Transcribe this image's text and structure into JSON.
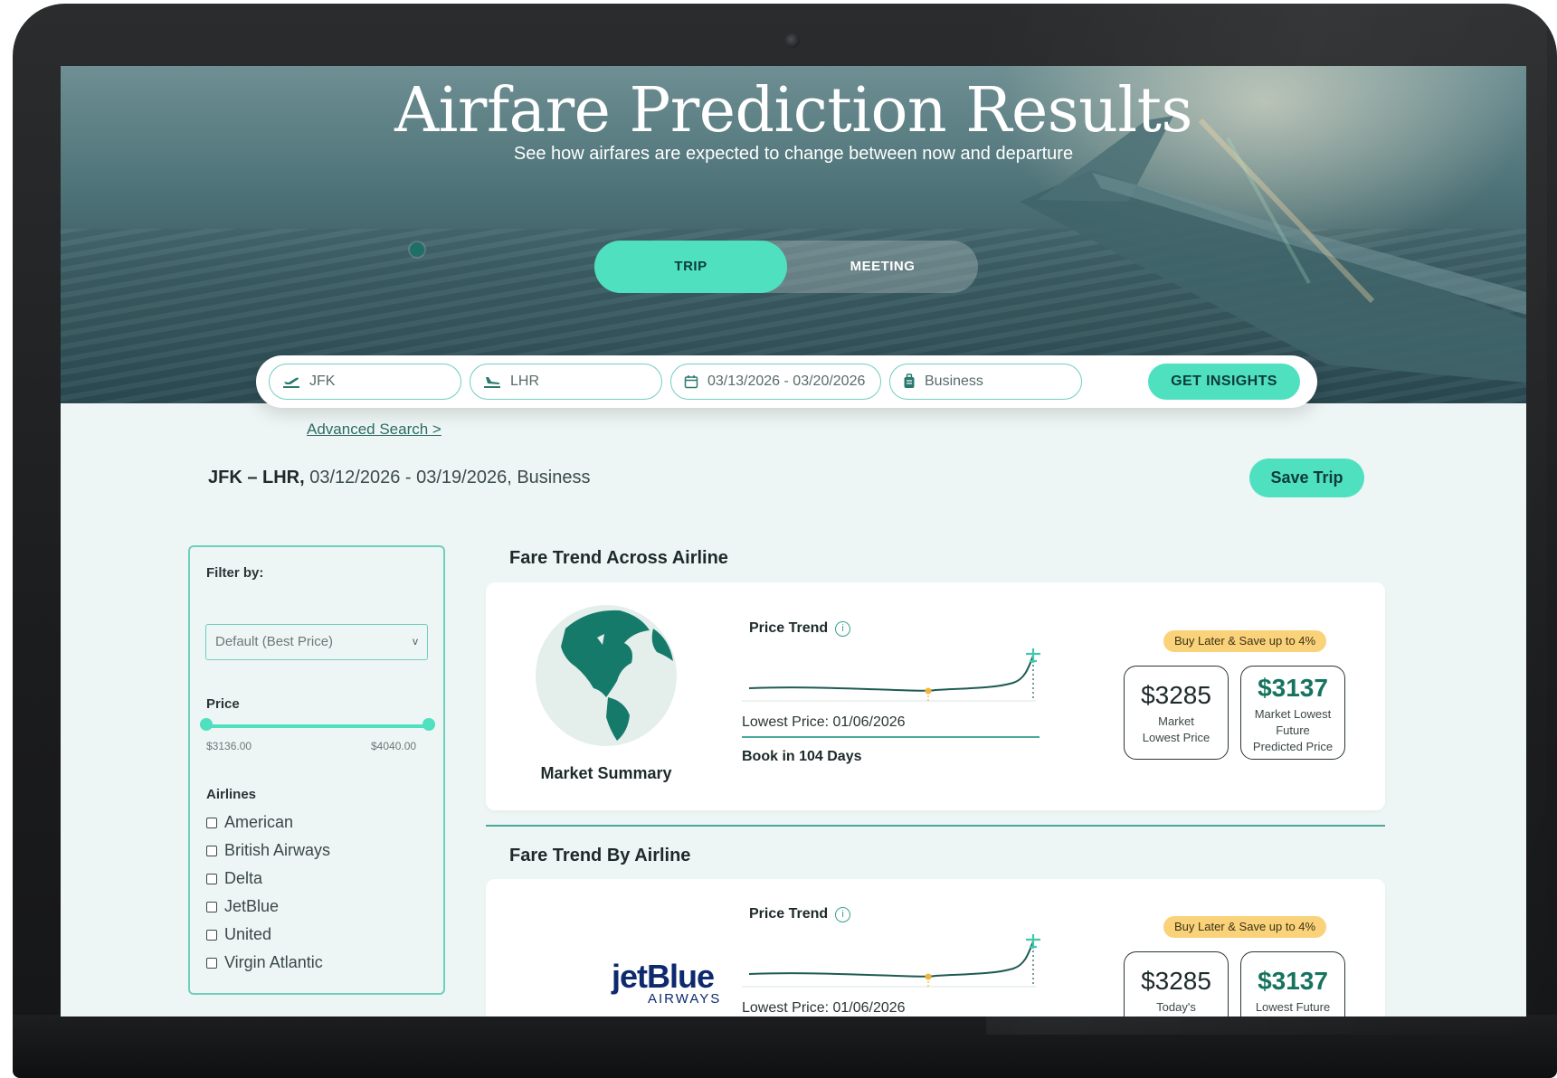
{
  "hero": {
    "title": "Airfare Prediction Results",
    "subtitle": "See how airfares are expected to change between now and departure"
  },
  "mode_toggle": {
    "options": [
      "TRIP",
      "MEETING"
    ],
    "selected": "TRIP"
  },
  "search": {
    "origin": "JFK",
    "destination": "LHR",
    "dates": "03/13/2026 - 03/20/2026",
    "cabin": "Business",
    "button_label": "GET INSIGHTS",
    "advanced_link": "Advanced Search >"
  },
  "trip_summary": {
    "route": "JFK – LHR,",
    "dates": "03/12/2026 - 03/19/2026,",
    "cabin": "Business",
    "save_label": "Save Trip"
  },
  "filter": {
    "title": "Filter by:",
    "sort_value": "Default (Best Price)",
    "price_label": "Price",
    "price_min": "$3136.00",
    "price_max": "$4040.00",
    "airlines_label": "Airlines",
    "airlines": [
      {
        "name": "American",
        "checked": false
      },
      {
        "name": "British Airways",
        "checked": false
      },
      {
        "name": "Delta",
        "checked": false
      },
      {
        "name": "JetBlue",
        "checked": false
      },
      {
        "name": "United",
        "checked": false
      },
      {
        "name": "Virgin Atlantic",
        "checked": false
      }
    ]
  },
  "market_section": {
    "title": "Fare Trend Across Airline",
    "summary_label": "Market Summary",
    "price_trend_label": "Price Trend",
    "lowest_price": "Lowest Price: 01/06/2026",
    "book_in": "Book in 104 Days",
    "badge": "Buy Later & Save up to 4%",
    "current_price": "$3285",
    "current_caption_1": "Market",
    "current_caption_2": "Lowest Price",
    "future_price": "$3137",
    "future_caption_1": "Market Lowest",
    "future_caption_2": "Future",
    "future_caption_3": "Predicted Price"
  },
  "airline_section": {
    "title": "Fare Trend By Airline",
    "airline_logo": "jetBlue",
    "airline_logo_sub": "AIRWAYS",
    "price_trend_label": "Price Trend",
    "lowest_price": "Lowest Price: 01/06/2026",
    "badge": "Buy Later & Save up to 4%",
    "current_price": "$3285",
    "current_caption": "Today's",
    "future_price": "$3137",
    "future_caption": "Lowest Future"
  },
  "colors": {
    "accent": "#4fe0c0",
    "accent_dark": "#16735f",
    "badge": "#f9d27a",
    "lowest_marker": "#f2b53a",
    "page_bg": "#eef6f5"
  }
}
